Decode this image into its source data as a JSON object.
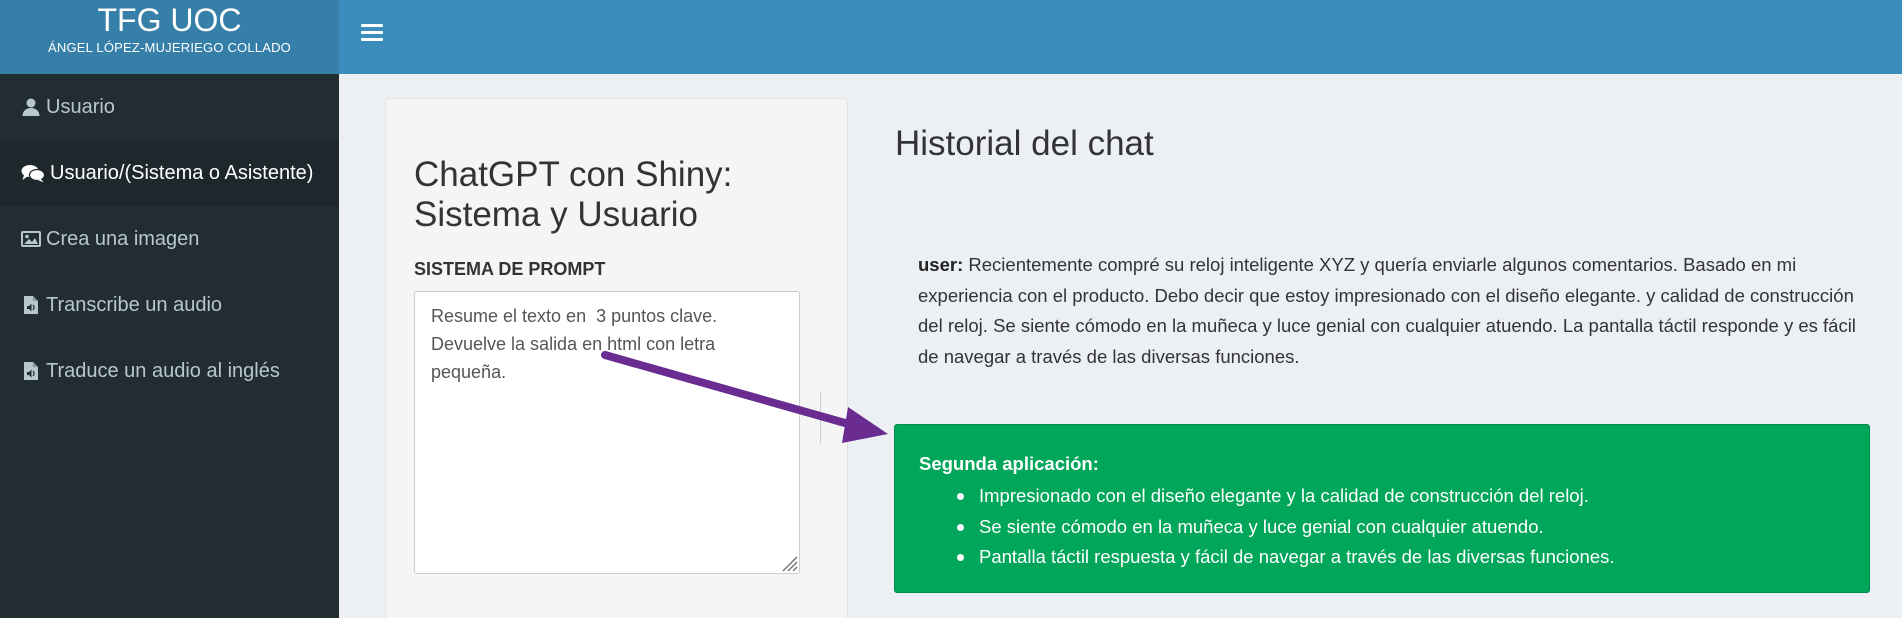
{
  "brand": {
    "title": "TFG UOC",
    "subtitle": "ÁNGEL LÓPEZ-MUJERIEGO COLLADO"
  },
  "sidebar": {
    "items": [
      {
        "label": "Usuario",
        "icon": "user-icon"
      },
      {
        "label": "Usuario/(Sistema o Asistente)",
        "icon": "comments-icon",
        "active": true
      },
      {
        "label": "Crea una imagen",
        "icon": "image-icon"
      },
      {
        "label": "Transcribe un audio",
        "icon": "audio-file-icon"
      },
      {
        "label": "Traduce un audio al inglés",
        "icon": "audio-file-icon"
      }
    ]
  },
  "card": {
    "title": "ChatGPT con Shiny: Sistema y Usuario",
    "prompt_label": "SISTEMA DE PROMPT",
    "prompt_value": "Resume el texto en  3 puntos clave. Devuelve la salida en html con letra pequeña."
  },
  "chat": {
    "heading": "Historial del chat",
    "user_label": "user:",
    "user_text": " Recientemente compré su reloj inteligente XYZ y quería enviarle algunos comentarios. Basado en mi experiencia con el producto. Debo decir que estoy impresionado con el diseño elegante. y calidad de construcción del reloj. Se siente cómodo en la muñeca y luce genial con cualquier atuendo. La pantalla táctil responde y es fácil de navegar a través de las diversas funciones.",
    "assistant_title": "Segunda aplicación:",
    "assistant_points": [
      "Impresionado con el diseño elegante y la calidad de construcción del reloj.",
      "Se siente cómodo en la muñeca y luce genial con cualquier atuendo.",
      "Pantalla táctil respuesta y fácil de navegar a través de las diversas funciones."
    ]
  },
  "colors": {
    "header": "#3c8dbc",
    "brand": "#367fa9",
    "sidebar": "#222d32",
    "success": "#00a65a",
    "arrow": "#6a2c91"
  }
}
